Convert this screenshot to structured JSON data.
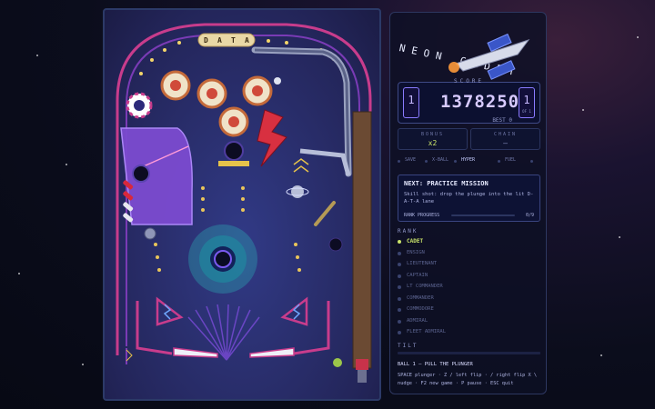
{
  "playfield": {
    "data_letters": [
      "D",
      "A",
      "T",
      "A"
    ]
  },
  "panel": {
    "logo_text": "NEON CADET",
    "score": {
      "label": "SCORE",
      "value": "1378250",
      "best": "BEST 0",
      "player_current": "1",
      "player_total": "1",
      "player_of": "OF 1"
    },
    "bonus": {
      "label": "BONUS",
      "value": "x2"
    },
    "chain": {
      "label": "CHAIN",
      "value": "—"
    },
    "modes": [
      "SAVE",
      "X-BALL",
      "HYPER",
      "FUEL"
    ],
    "active_mode": "HYPER",
    "mission": {
      "title": "NEXT: PRACTICE MISSION",
      "description": "Skill shot: drop the plunge into the lit D-A-T-A lane",
      "progress_label": "RANK PROGRESS",
      "progress_value": "0/9",
      "progress_fraction": 0
    },
    "rank_label": "RANK",
    "ranks": [
      {
        "label": "CADET",
        "current": true
      },
      {
        "label": "ENSIGN",
        "current": false
      },
      {
        "label": "LIEUTENANT",
        "current": false
      },
      {
        "label": "CAPTAIN",
        "current": false
      },
      {
        "label": "LT COMMANDER",
        "current": false
      },
      {
        "label": "COMMANDER",
        "current": false
      },
      {
        "label": "COMMODORE",
        "current": false
      },
      {
        "label": "ADMIRAL",
        "current": false
      },
      {
        "label": "FLEET ADMIRAL",
        "current": false
      }
    ],
    "tilt_label": "TILT",
    "ball_status": "BALL 1 — PULL THE PLUNGER",
    "controls_help": "SPACE plunger · Z / left flip · / right flip X \\ nudge · F2 new game · P pause · ESC quit"
  },
  "colors": {
    "accent_violet": "#8a7bff",
    "accent_lime": "#c9e36a",
    "playfield_blue": "#2a2f6e",
    "rail_pink": "#c83c8c"
  }
}
